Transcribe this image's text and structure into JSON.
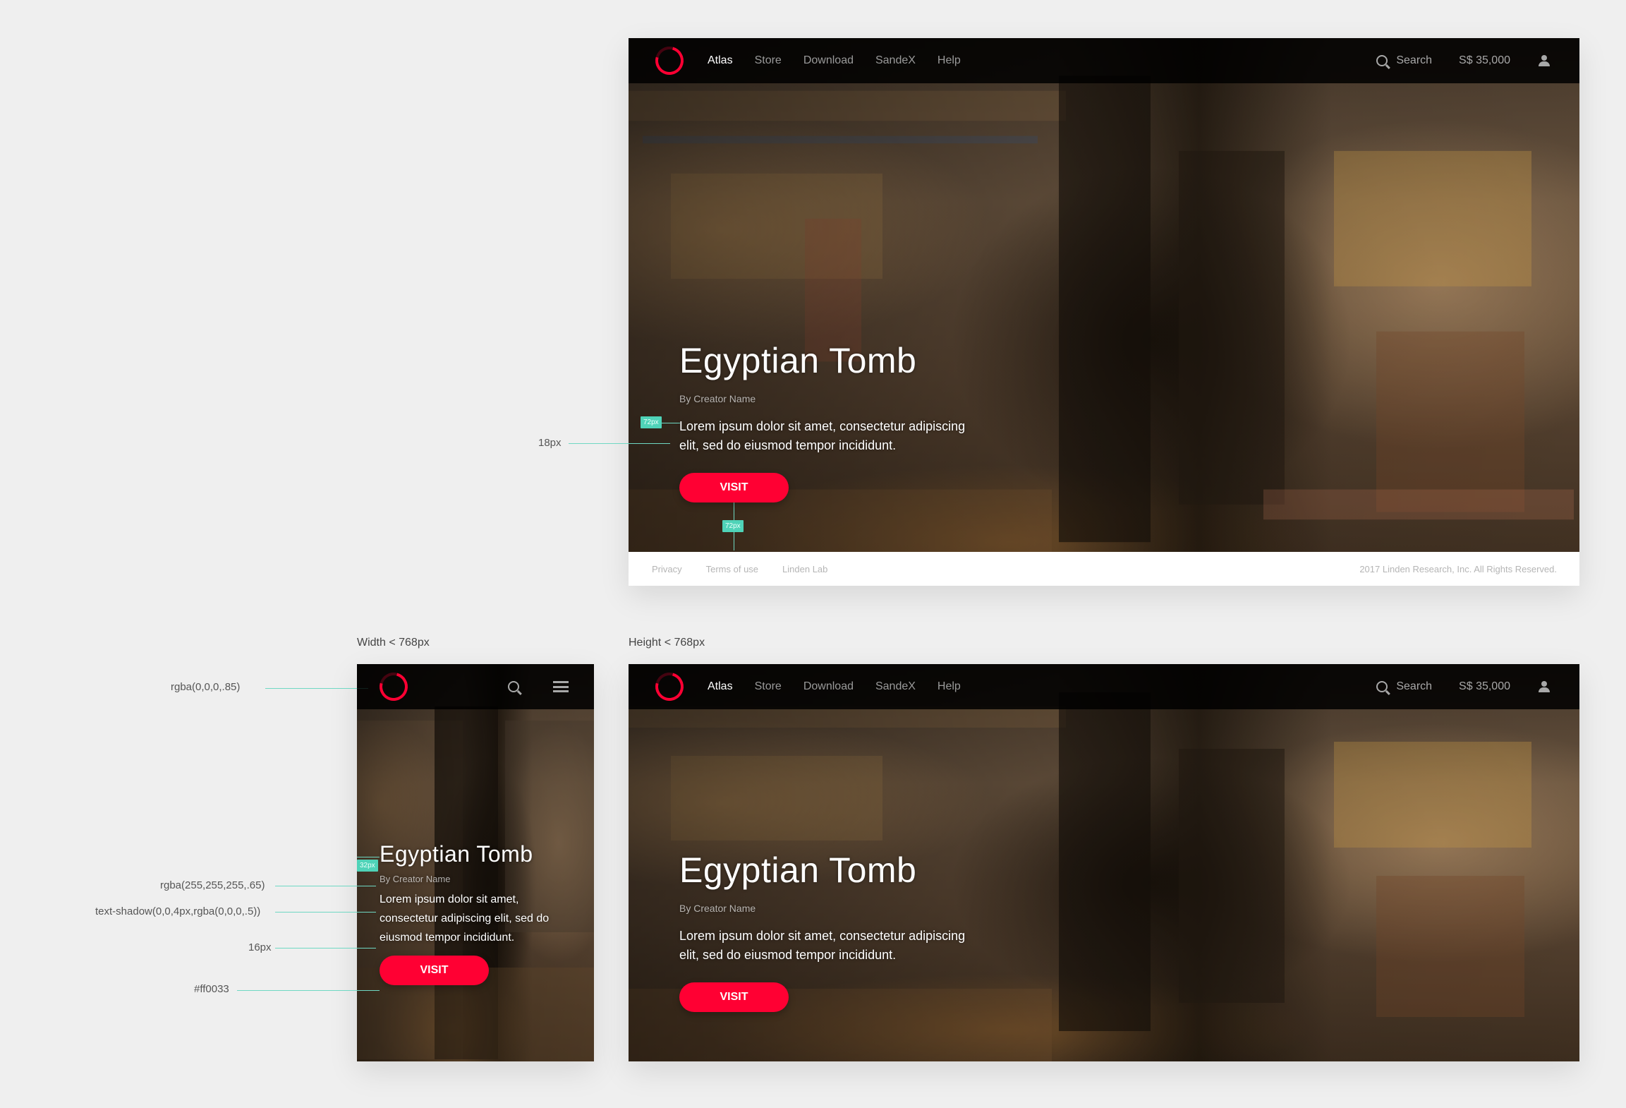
{
  "brand": {
    "accent": "#ff0033",
    "bar_bg": "rgba(0,0,0,.85)"
  },
  "nav": {
    "items": [
      {
        "label": "Atlas",
        "active": true
      },
      {
        "label": "Store",
        "active": false
      },
      {
        "label": "Download",
        "active": false
      },
      {
        "label": "SandeX",
        "active": false
      },
      {
        "label": "Help",
        "active": false
      }
    ],
    "search_label": "Search",
    "balance": "S$ 35,000",
    "icons": [
      "logo-ring-icon",
      "search-icon",
      "user-icon",
      "hamburger-menu-icon"
    ]
  },
  "hero": {
    "title": "Egyptian Tomb",
    "creator": "By Creator Name",
    "description": "Lorem ipsum dolor sit amet, consectetur adipiscing elit, sed do eiusmod tempor incididunt.",
    "button": "VISIT"
  },
  "footer": {
    "links": [
      "Privacy",
      "Terms of use",
      "Linden Lab"
    ],
    "copyright": "2017 Linden Research, Inc. All Rights  Reserved."
  },
  "annotations": {
    "width_label": "Width < 768px",
    "height_label": "Height < 768px",
    "spacing_18": "18px",
    "spacing_72": "72px",
    "spacing_32": "32px",
    "bar_color": "rgba(0,0,0,.85)",
    "creator_color": "rgba(255,255,255,.65)",
    "text_shadow": "text-shadow(0,0,4px,rgba(0,0,0,.5))",
    "font_16": "16px",
    "button_color": "#ff0033"
  }
}
